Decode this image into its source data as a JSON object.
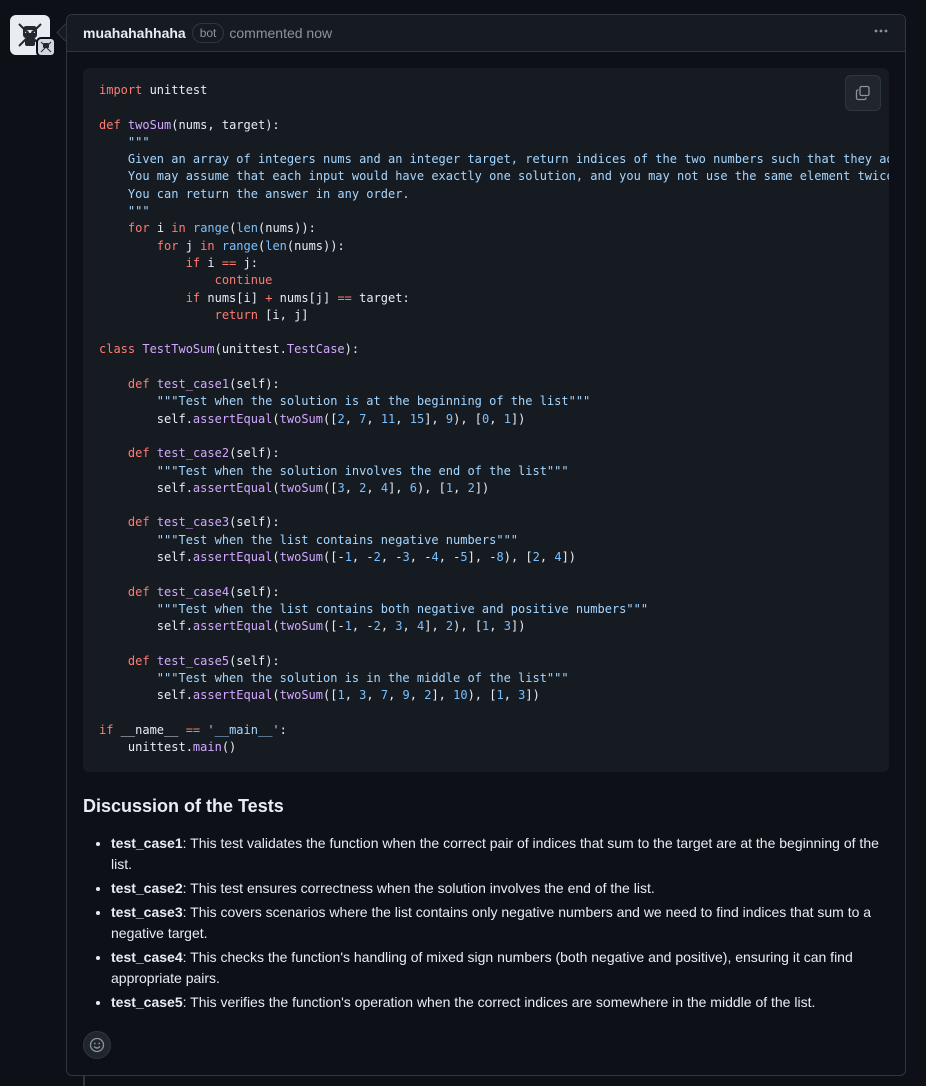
{
  "comment": {
    "author": "muahahahhaha",
    "bot_label": "bot",
    "timestamp": "commented now",
    "menu_icon": "kebab-horizontal-icon"
  },
  "code": {
    "language": "python",
    "copy_icon": "copy-icon",
    "lines": [
      [
        [
          "kw",
          "import"
        ],
        [
          "pl",
          " unittest"
        ]
      ],
      [],
      [
        [
          "kw",
          "def"
        ],
        [
          "pl",
          " "
        ],
        [
          "fn",
          "twoSum"
        ],
        [
          "pl",
          "(nums, target):"
        ]
      ],
      [
        [
          "str",
          "    \"\"\""
        ]
      ],
      [
        [
          "str",
          "    Given an array of integers nums and an integer target, return indices of the two numbers such that they add"
        ]
      ],
      [
        [
          "str",
          "    You may assume that each input would have exactly one solution, and you may not use the same element twice"
        ]
      ],
      [
        [
          "str",
          "    You can return the answer in any order."
        ]
      ],
      [
        [
          "str",
          "    \"\"\""
        ]
      ],
      [
        [
          "pl",
          "    "
        ],
        [
          "kw",
          "for"
        ],
        [
          "pl",
          " i "
        ],
        [
          "kw",
          "in"
        ],
        [
          "pl",
          " "
        ],
        [
          "bi",
          "range"
        ],
        [
          "pl",
          "("
        ],
        [
          "bi",
          "len"
        ],
        [
          "pl",
          "(nums)):"
        ]
      ],
      [
        [
          "pl",
          "        "
        ],
        [
          "kw",
          "for"
        ],
        [
          "pl",
          " j "
        ],
        [
          "kw",
          "in"
        ],
        [
          "pl",
          " "
        ],
        [
          "bi",
          "range"
        ],
        [
          "pl",
          "("
        ],
        [
          "bi",
          "len"
        ],
        [
          "pl",
          "(nums)):"
        ]
      ],
      [
        [
          "pl",
          "            "
        ],
        [
          "kw",
          "if"
        ],
        [
          "pl",
          " i "
        ],
        [
          "op",
          "=="
        ],
        [
          "pl",
          " j:"
        ]
      ],
      [
        [
          "pl",
          "                "
        ],
        [
          "kw",
          "continue"
        ]
      ],
      [
        [
          "pl",
          "            "
        ],
        [
          "kw",
          "if"
        ],
        [
          "pl",
          " nums[i] "
        ],
        [
          "op",
          "+"
        ],
        [
          "pl",
          " nums[j] "
        ],
        [
          "op",
          "=="
        ],
        [
          "pl",
          " target:"
        ]
      ],
      [
        [
          "pl",
          "                "
        ],
        [
          "kw",
          "return"
        ],
        [
          "pl",
          " [i, j]"
        ]
      ],
      [],
      [
        [
          "kw",
          "class"
        ],
        [
          "pl",
          " "
        ],
        [
          "cls",
          "TestTwoSum"
        ],
        [
          "pl",
          "(unittest."
        ],
        [
          "cls",
          "TestCase"
        ],
        [
          "pl",
          "):"
        ]
      ],
      [],
      [
        [
          "pl",
          "    "
        ],
        [
          "kw",
          "def"
        ],
        [
          "pl",
          " "
        ],
        [
          "fn",
          "test_case1"
        ],
        [
          "pl",
          "(self):"
        ]
      ],
      [
        [
          "str",
          "        \"\"\"Test when the solution is at the beginning of the list\"\"\""
        ]
      ],
      [
        [
          "pl",
          "        self."
        ],
        [
          "fn",
          "assertEqual"
        ],
        [
          "pl",
          "("
        ],
        [
          "fn",
          "twoSum"
        ],
        [
          "pl",
          "(["
        ],
        [
          "num",
          "2"
        ],
        [
          "pl",
          ", "
        ],
        [
          "num",
          "7"
        ],
        [
          "pl",
          ", "
        ],
        [
          "num",
          "11"
        ],
        [
          "pl",
          ", "
        ],
        [
          "num",
          "15"
        ],
        [
          "pl",
          "], "
        ],
        [
          "num",
          "9"
        ],
        [
          "pl",
          "), ["
        ],
        [
          "num",
          "0"
        ],
        [
          "pl",
          ", "
        ],
        [
          "num",
          "1"
        ],
        [
          "pl",
          "])"
        ]
      ],
      [],
      [
        [
          "pl",
          "    "
        ],
        [
          "kw",
          "def"
        ],
        [
          "pl",
          " "
        ],
        [
          "fn",
          "test_case2"
        ],
        [
          "pl",
          "(self):"
        ]
      ],
      [
        [
          "str",
          "        \"\"\"Test when the solution involves the end of the list\"\"\""
        ]
      ],
      [
        [
          "pl",
          "        self."
        ],
        [
          "fn",
          "assertEqual"
        ],
        [
          "pl",
          "("
        ],
        [
          "fn",
          "twoSum"
        ],
        [
          "pl",
          "(["
        ],
        [
          "num",
          "3"
        ],
        [
          "pl",
          ", "
        ],
        [
          "num",
          "2"
        ],
        [
          "pl",
          ", "
        ],
        [
          "num",
          "4"
        ],
        [
          "pl",
          "], "
        ],
        [
          "num",
          "6"
        ],
        [
          "pl",
          "), ["
        ],
        [
          "num",
          "1"
        ],
        [
          "pl",
          ", "
        ],
        [
          "num",
          "2"
        ],
        [
          "pl",
          "])"
        ]
      ],
      [],
      [
        [
          "pl",
          "    "
        ],
        [
          "kw",
          "def"
        ],
        [
          "pl",
          " "
        ],
        [
          "fn",
          "test_case3"
        ],
        [
          "pl",
          "(self):"
        ]
      ],
      [
        [
          "str",
          "        \"\"\"Test when the list contains negative numbers\"\"\""
        ]
      ],
      [
        [
          "pl",
          "        self."
        ],
        [
          "fn",
          "assertEqual"
        ],
        [
          "pl",
          "("
        ],
        [
          "fn",
          "twoSum"
        ],
        [
          "pl",
          "([-"
        ],
        [
          "num",
          "1"
        ],
        [
          "pl",
          ", -"
        ],
        [
          "num",
          "2"
        ],
        [
          "pl",
          ", -"
        ],
        [
          "num",
          "3"
        ],
        [
          "pl",
          ", -"
        ],
        [
          "num",
          "4"
        ],
        [
          "pl",
          ", -"
        ],
        [
          "num",
          "5"
        ],
        [
          "pl",
          "], -"
        ],
        [
          "num",
          "8"
        ],
        [
          "pl",
          "), ["
        ],
        [
          "num",
          "2"
        ],
        [
          "pl",
          ", "
        ],
        [
          "num",
          "4"
        ],
        [
          "pl",
          "])"
        ]
      ],
      [],
      [
        [
          "pl",
          "    "
        ],
        [
          "kw",
          "def"
        ],
        [
          "pl",
          " "
        ],
        [
          "fn",
          "test_case4"
        ],
        [
          "pl",
          "(self):"
        ]
      ],
      [
        [
          "str",
          "        \"\"\"Test when the list contains both negative and positive numbers\"\"\""
        ]
      ],
      [
        [
          "pl",
          "        self."
        ],
        [
          "fn",
          "assertEqual"
        ],
        [
          "pl",
          "("
        ],
        [
          "fn",
          "twoSum"
        ],
        [
          "pl",
          "([-"
        ],
        [
          "num",
          "1"
        ],
        [
          "pl",
          ", -"
        ],
        [
          "num",
          "2"
        ],
        [
          "pl",
          ", "
        ],
        [
          "num",
          "3"
        ],
        [
          "pl",
          ", "
        ],
        [
          "num",
          "4"
        ],
        [
          "pl",
          "], "
        ],
        [
          "num",
          "2"
        ],
        [
          "pl",
          "), ["
        ],
        [
          "num",
          "1"
        ],
        [
          "pl",
          ", "
        ],
        [
          "num",
          "3"
        ],
        [
          "pl",
          "])"
        ]
      ],
      [],
      [
        [
          "pl",
          "    "
        ],
        [
          "kw",
          "def"
        ],
        [
          "pl",
          " "
        ],
        [
          "fn",
          "test_case5"
        ],
        [
          "pl",
          "(self):"
        ]
      ],
      [
        [
          "str",
          "        \"\"\"Test when the solution is in the middle of the list\"\"\""
        ]
      ],
      [
        [
          "pl",
          "        self."
        ],
        [
          "fn",
          "assertEqual"
        ],
        [
          "pl",
          "("
        ],
        [
          "fn",
          "twoSum"
        ],
        [
          "pl",
          "(["
        ],
        [
          "num",
          "1"
        ],
        [
          "pl",
          ", "
        ],
        [
          "num",
          "3"
        ],
        [
          "pl",
          ", "
        ],
        [
          "num",
          "7"
        ],
        [
          "pl",
          ", "
        ],
        [
          "num",
          "9"
        ],
        [
          "pl",
          ", "
        ],
        [
          "num",
          "2"
        ],
        [
          "pl",
          "], "
        ],
        [
          "num",
          "10"
        ],
        [
          "pl",
          "), ["
        ],
        [
          "num",
          "1"
        ],
        [
          "pl",
          ", "
        ],
        [
          "num",
          "3"
        ],
        [
          "pl",
          "])"
        ]
      ],
      [],
      [
        [
          "kw",
          "if"
        ],
        [
          "pl",
          " __name__ "
        ],
        [
          "op",
          "=="
        ],
        [
          "pl",
          " "
        ],
        [
          "str",
          "'__main__'"
        ],
        [
          "pl",
          ":"
        ]
      ],
      [
        [
          "pl",
          "    unittest."
        ],
        [
          "fn",
          "main"
        ],
        [
          "pl",
          "()"
        ]
      ]
    ]
  },
  "discussion": {
    "title": "Discussion of the Tests",
    "items": [
      {
        "name": "test_case1",
        "text": ": This test validates the function when the correct pair of indices that sum to the target are at the beginning of the list."
      },
      {
        "name": "test_case2",
        "text": ": This test ensures correctness when the solution involves the end of the list."
      },
      {
        "name": "test_case3",
        "text": ": This covers scenarios where the list contains only negative numbers and we need to find indices that sum to a negative target."
      },
      {
        "name": "test_case4",
        "text": ": This checks the function's handling of mixed sign numbers (both negative and positive), ensuring it can find appropriate pairs."
      },
      {
        "name": "test_case5",
        "text": ": This verifies the function's operation when the correct indices are somewhere in the middle of the list."
      }
    ]
  },
  "reaction_icon": "smiley-icon",
  "colors": {
    "background": "#0d1117",
    "header_bg": "#161b22",
    "border": "#30363d",
    "keyword": "#ff7b72",
    "function": "#d2a8ff",
    "string": "#a5d6ff",
    "number": "#79c0ff"
  }
}
